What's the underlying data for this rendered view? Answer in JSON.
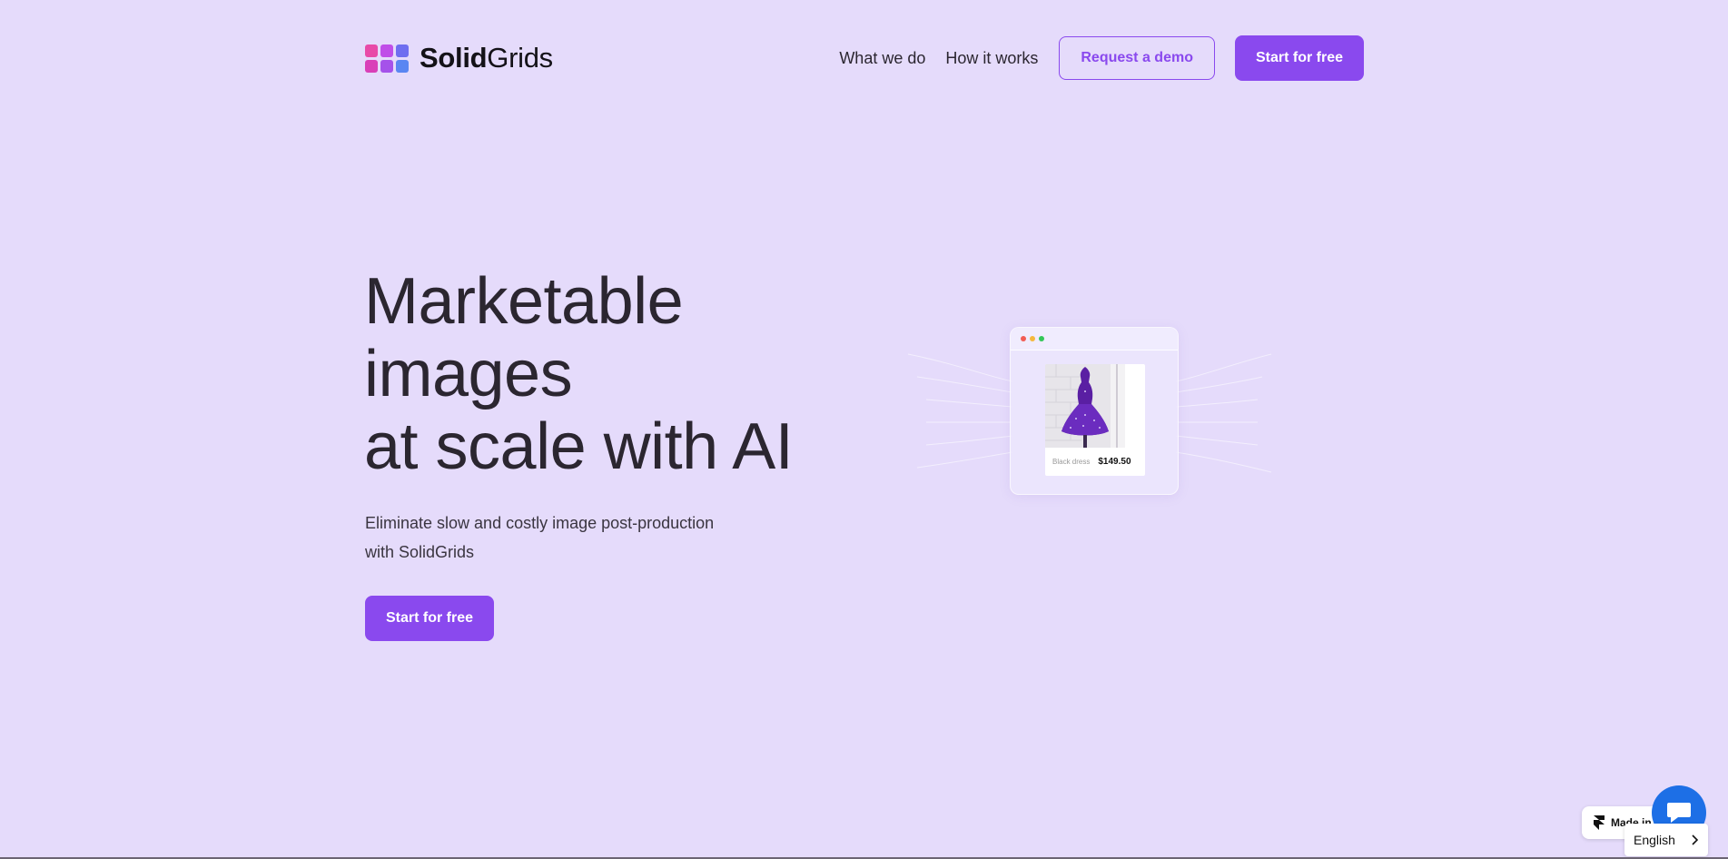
{
  "brand": {
    "bold": "Solid",
    "light": "Grids",
    "logo_colors": [
      "#e84aa8",
      "#c04ee8",
      "#6f6ef0",
      "#d93fb8",
      "#a552ea",
      "#5a86f2"
    ]
  },
  "nav": {
    "links": [
      "What we do",
      "How it works"
    ],
    "request_demo": "Request a demo",
    "start_free": "Start for free"
  },
  "hero": {
    "title_lines": [
      "Marketable",
      "images",
      "at scale with AI"
    ],
    "subtitle": "Eliminate slow and costly image post-production with SolidGrids",
    "cta": "Start for free"
  },
  "mockup": {
    "window_dots": [
      "#f25c54",
      "#f5b83d",
      "#34c759"
    ],
    "product_name": "Black dress",
    "product_price": "$149.50"
  },
  "widgets": {
    "made_in": "Made in",
    "language": "English"
  },
  "colors": {
    "background": "#e5dbfb",
    "accent": "#8a49ee",
    "chat": "#1d6fe6"
  }
}
